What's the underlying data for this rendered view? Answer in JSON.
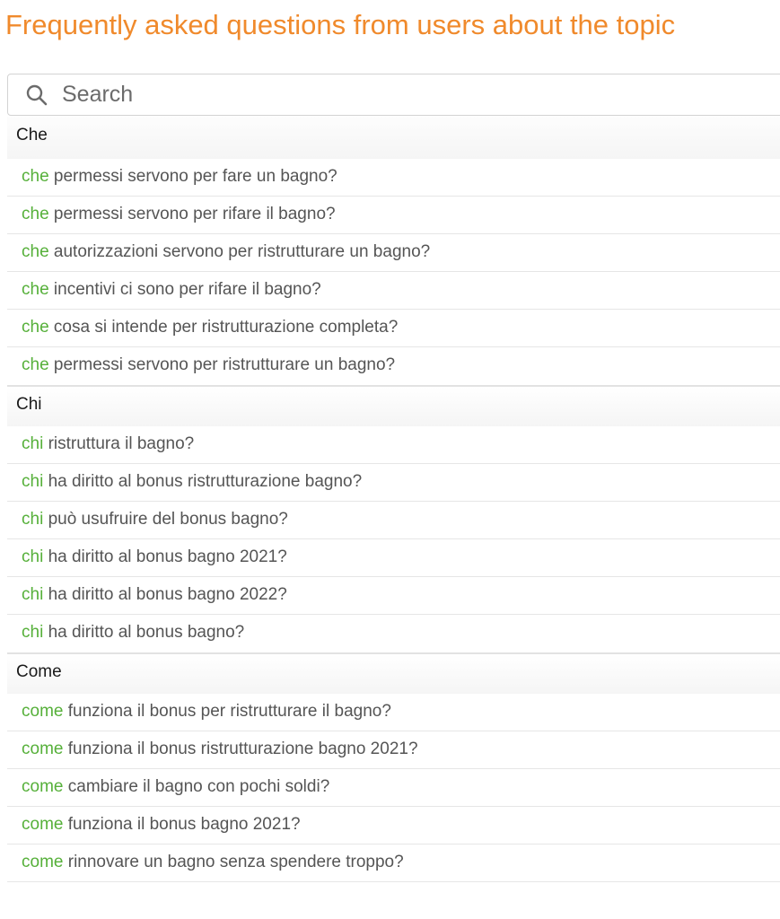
{
  "header": {
    "title": "Frequently asked questions from users about the topic"
  },
  "search": {
    "placeholder": "Search",
    "value": ""
  },
  "colors": {
    "title": "#f08a2c",
    "keyword": "#56b03a",
    "question_text": "#555555"
  },
  "icons": {
    "search": "search-icon"
  },
  "groups": [
    {
      "label": "Che",
      "items": [
        {
          "keyword": "che",
          "rest": " permessi servono per fare un bagno?"
        },
        {
          "keyword": "che",
          "rest": " permessi servono per rifare il bagno?"
        },
        {
          "keyword": "che",
          "rest": " autorizzazioni servono per ristrutturare un bagno?"
        },
        {
          "keyword": "che",
          "rest": " incentivi ci sono per rifare il bagno?"
        },
        {
          "keyword": "che",
          "rest": " cosa si intende per ristrutturazione completa?"
        },
        {
          "keyword": "che",
          "rest": " permessi servono per ristrutturare un bagno?"
        }
      ]
    },
    {
      "label": "Chi",
      "items": [
        {
          "keyword": "chi",
          "rest": " ristruttura il bagno?"
        },
        {
          "keyword": "chi",
          "rest": " ha diritto al bonus ristrutturazione bagno?"
        },
        {
          "keyword": "chi",
          "rest": " può usufruire del bonus bagno?"
        },
        {
          "keyword": "chi",
          "rest": " ha diritto al bonus bagno 2021?"
        },
        {
          "keyword": "chi",
          "rest": " ha diritto al bonus bagno 2022?"
        },
        {
          "keyword": "chi",
          "rest": " ha diritto al bonus bagno?"
        }
      ]
    },
    {
      "label": "Come",
      "items": [
        {
          "keyword": "come",
          "rest": " funziona il bonus per ristrutturare il bagno?"
        },
        {
          "keyword": "come",
          "rest": " funziona il bonus ristrutturazione bagno 2021?"
        },
        {
          "keyword": "come",
          "rest": " cambiare il bagno con pochi soldi?"
        },
        {
          "keyword": "come",
          "rest": " funziona il bonus bagno 2021?"
        },
        {
          "keyword": "come",
          "rest": " rinnovare un bagno senza spendere troppo?"
        }
      ]
    }
  ]
}
